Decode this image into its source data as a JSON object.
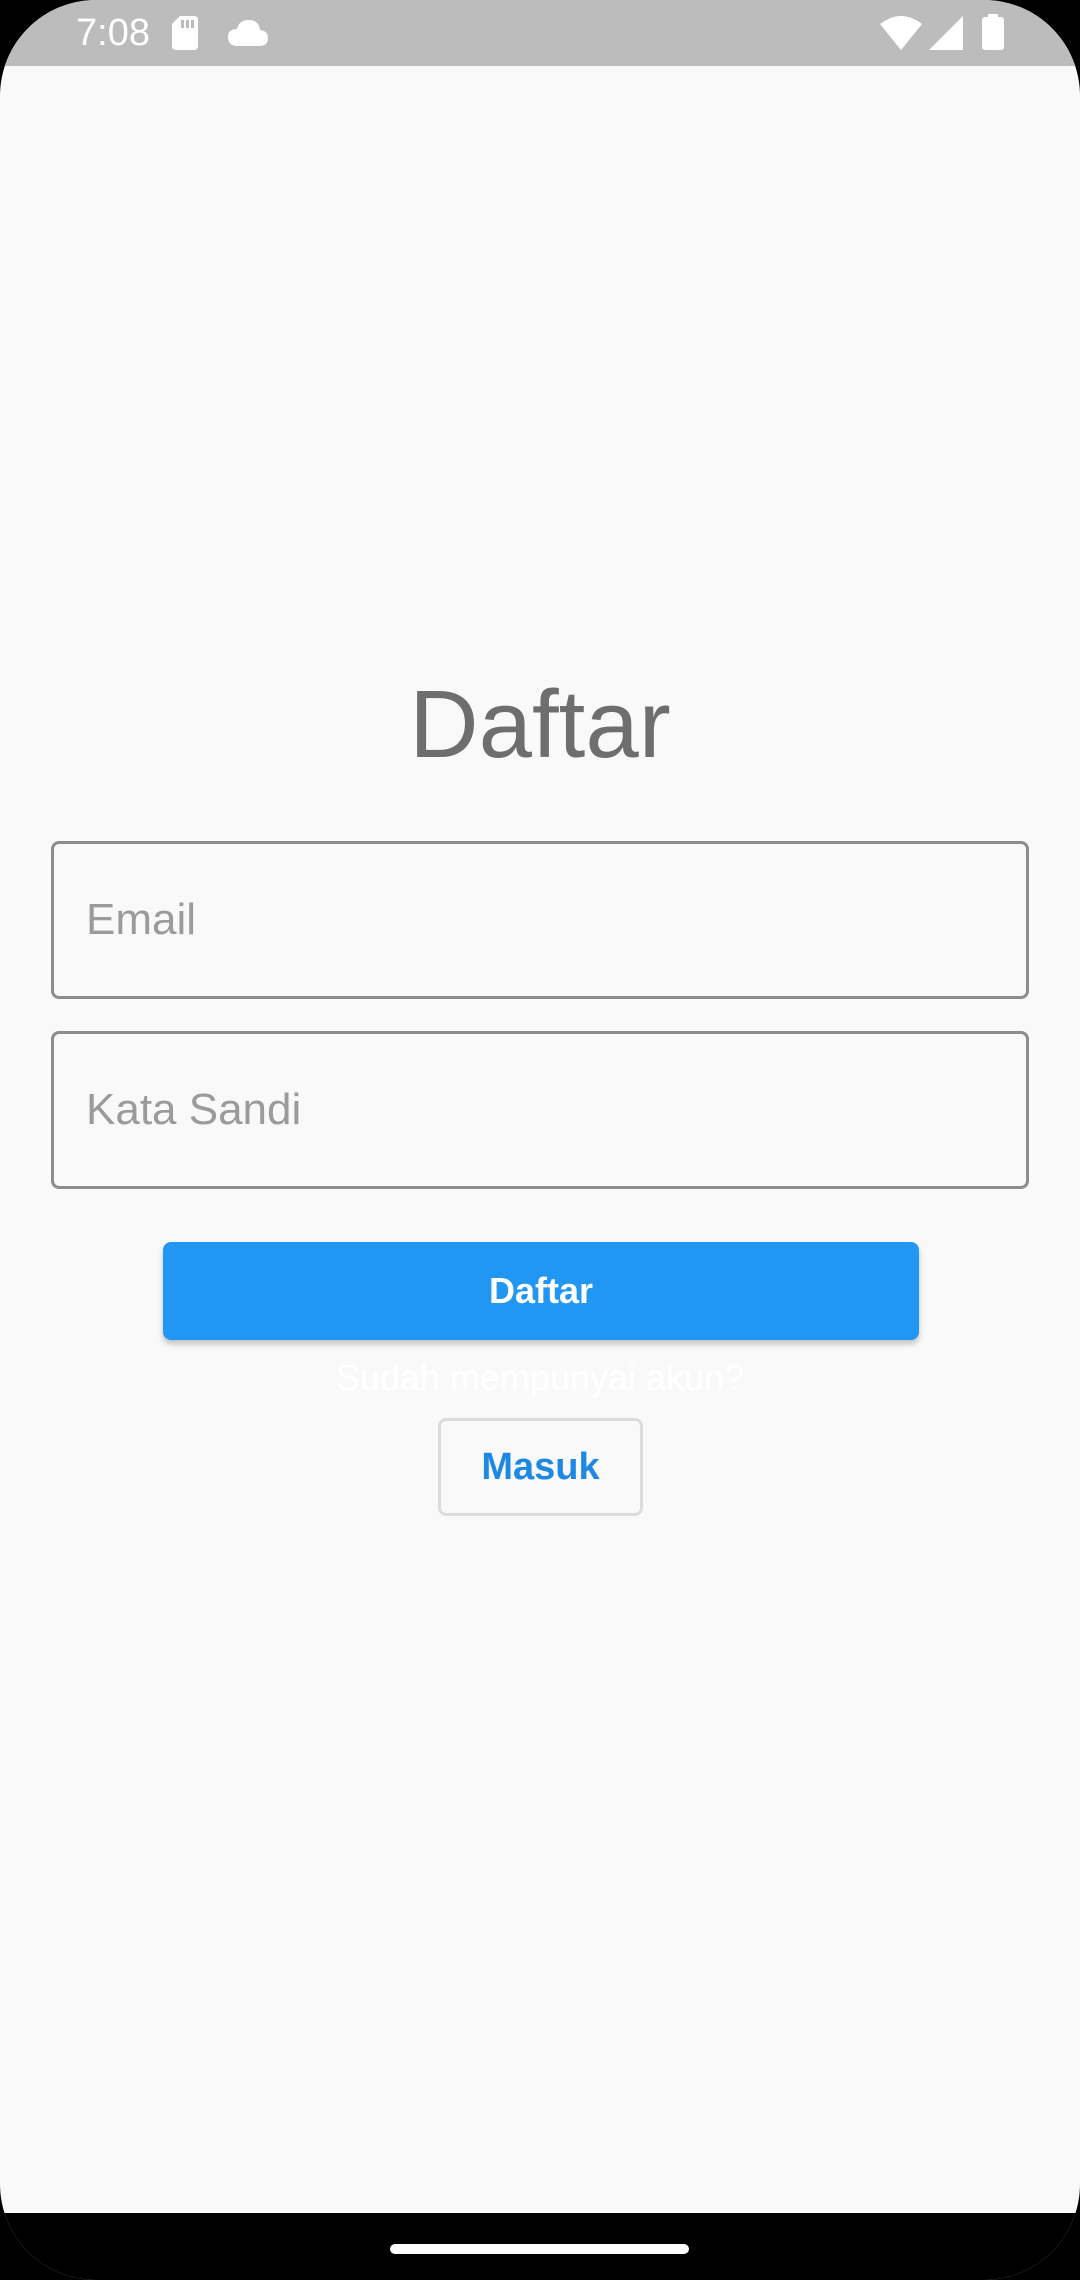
{
  "status_bar": {
    "time": "7:08",
    "icons": [
      "sd-card-icon",
      "cloud-icon",
      "wifi-icon",
      "cellular-signal-icon",
      "battery-icon"
    ],
    "background_color": "#bcbcbc"
  },
  "screen": {
    "title": "Daftar",
    "email_field": {
      "placeholder": "Email",
      "value": ""
    },
    "password_field": {
      "placeholder": "Kata Sandi",
      "value": ""
    },
    "register_button": {
      "label": "Daftar",
      "color": "#2196f3"
    },
    "login_prompt": "Sudah mempunyai akun?",
    "login_button": {
      "label": "Masuk",
      "color": "#1e88e5"
    }
  },
  "nav_bar": {
    "background_color": "#000000"
  }
}
